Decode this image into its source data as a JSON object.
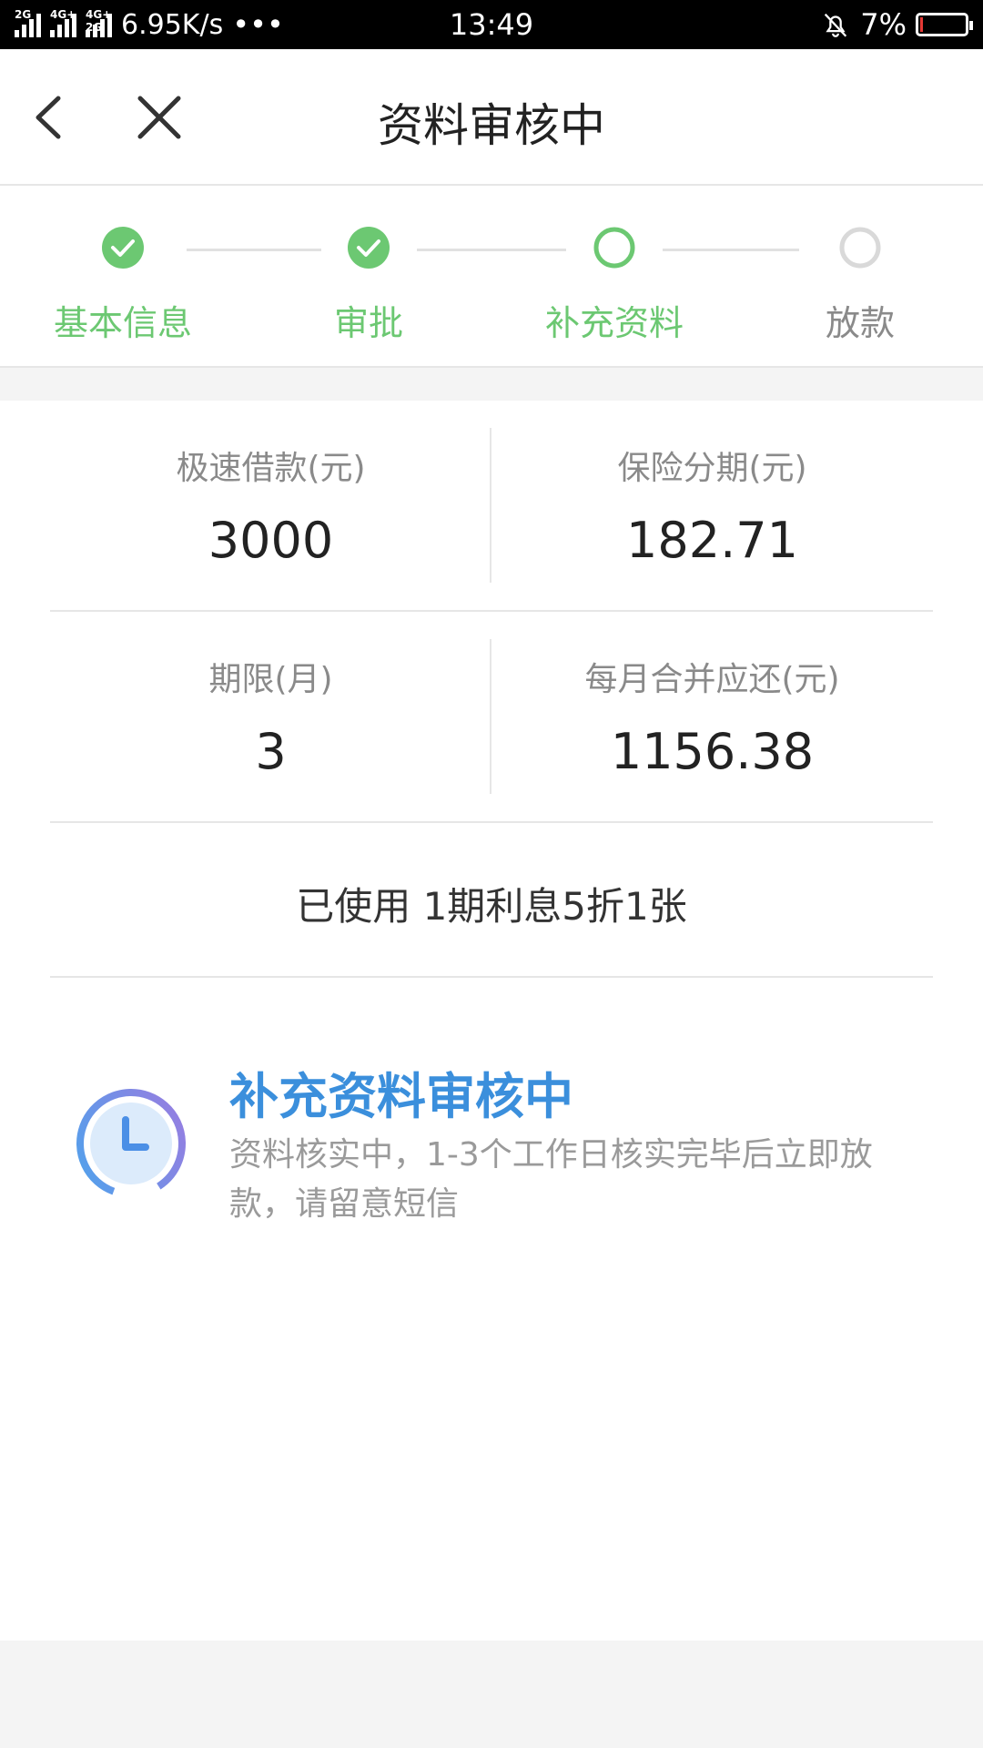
{
  "status_bar": {
    "net1": "2G",
    "net2": "4G+",
    "net3": "4G+ 2G",
    "speed": "6.95K/s",
    "dots": "•••",
    "time": "13:49",
    "battery": "7%",
    "battery_level": 0.07
  },
  "header": {
    "title": "资料审核中",
    "back_icon": "chevron-left-icon",
    "close_icon": "close-icon"
  },
  "steps": [
    {
      "label": "基本信息",
      "state": "done"
    },
    {
      "label": "审批",
      "state": "done"
    },
    {
      "label": "补充资料",
      "state": "current"
    },
    {
      "label": "放款",
      "state": "pending"
    }
  ],
  "colors": {
    "green": "#6cc872",
    "pending": "#d9d9d9",
    "blue": "#3b8fdc"
  },
  "info": {
    "loan_label": "极速借款(元)",
    "loan_value": "3000",
    "insurance_label": "保险分期(元)",
    "insurance_value": "182.71",
    "term_label": "期限(月)",
    "term_value": "3",
    "monthly_label": "每月合并应还(元)",
    "monthly_value": "1156.38"
  },
  "coupon": "已使用 1期利息5折1张",
  "review": {
    "title": "补充资料审核中",
    "description": "资料核实中，1-3个工作日核实完毕后立即放款，请留意短信",
    "icon": "clock-icon"
  }
}
